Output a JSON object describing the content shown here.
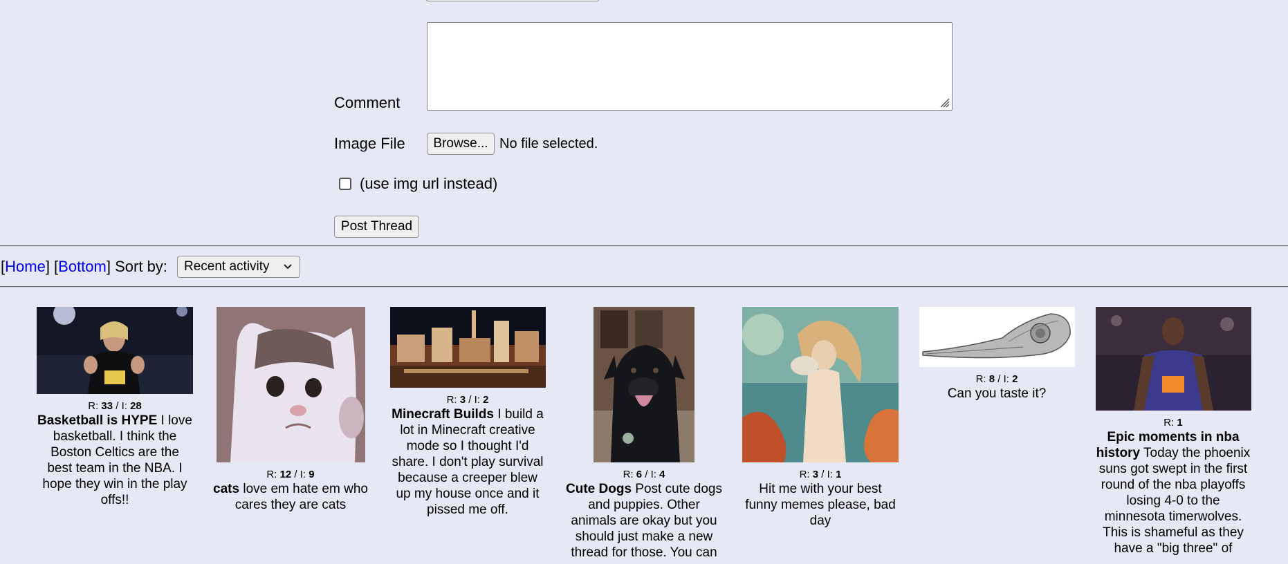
{
  "form": {
    "comment_label": "Comment",
    "image_label": "Image File",
    "browse_label": "Browse...",
    "file_status": "No file selected.",
    "url_option_label": "(use img url instead)",
    "submit_label": "Post Thread"
  },
  "nav": {
    "home_label": "Home",
    "bottom_label": "Bottom",
    "sort_label": "Sort by:",
    "sort_value": "Recent activity"
  },
  "threads": [
    {
      "r_label": "R:",
      "replies": "33",
      "sep": "/ I:",
      "images": "28",
      "subject": "Basketball is HYPE",
      "body": " I love basketball. I think the Boston Celtics are the best team in the NBA. I hope they win in the play offs!!"
    },
    {
      "r_label": "R:",
      "replies": "12",
      "sep": "/ I:",
      "images": "9",
      "subject": "cats",
      "body": " love em hate em who cares they are cats"
    },
    {
      "r_label": "R:",
      "replies": "3",
      "sep": "/ I:",
      "images": "2",
      "subject": "Minecraft Builds",
      "body": " I build a lot in Minecraft creative mode so I thought I'd share. I don't play survival because a creeper blew up my house once and it pissed me off."
    },
    {
      "r_label": "R:",
      "replies": "6",
      "sep": "/ I:",
      "images": "4",
      "subject": "Cute Dogs",
      "body": " Post cute dogs and puppies. Other animals are okay but you should just make a new thread for those. You can"
    },
    {
      "r_label": "R:",
      "replies": "3",
      "sep": "/ I:",
      "images": "1",
      "subject": "",
      "body": "Hit me with your best funny memes please, bad day"
    },
    {
      "r_label": "R:",
      "replies": "8",
      "sep": "/ I:",
      "images": "2",
      "subject": "",
      "body": "Can you taste it?"
    },
    {
      "r_label": "R:",
      "replies": "1",
      "sep": "",
      "images": "",
      "subject": "Epic moments in nba history",
      "body": " Today the phoenix suns got swept in the first round of the nba playoffs losing 4-0 to the minnesota timerwolves. This is shameful as they have a \"big three\" of"
    }
  ]
}
